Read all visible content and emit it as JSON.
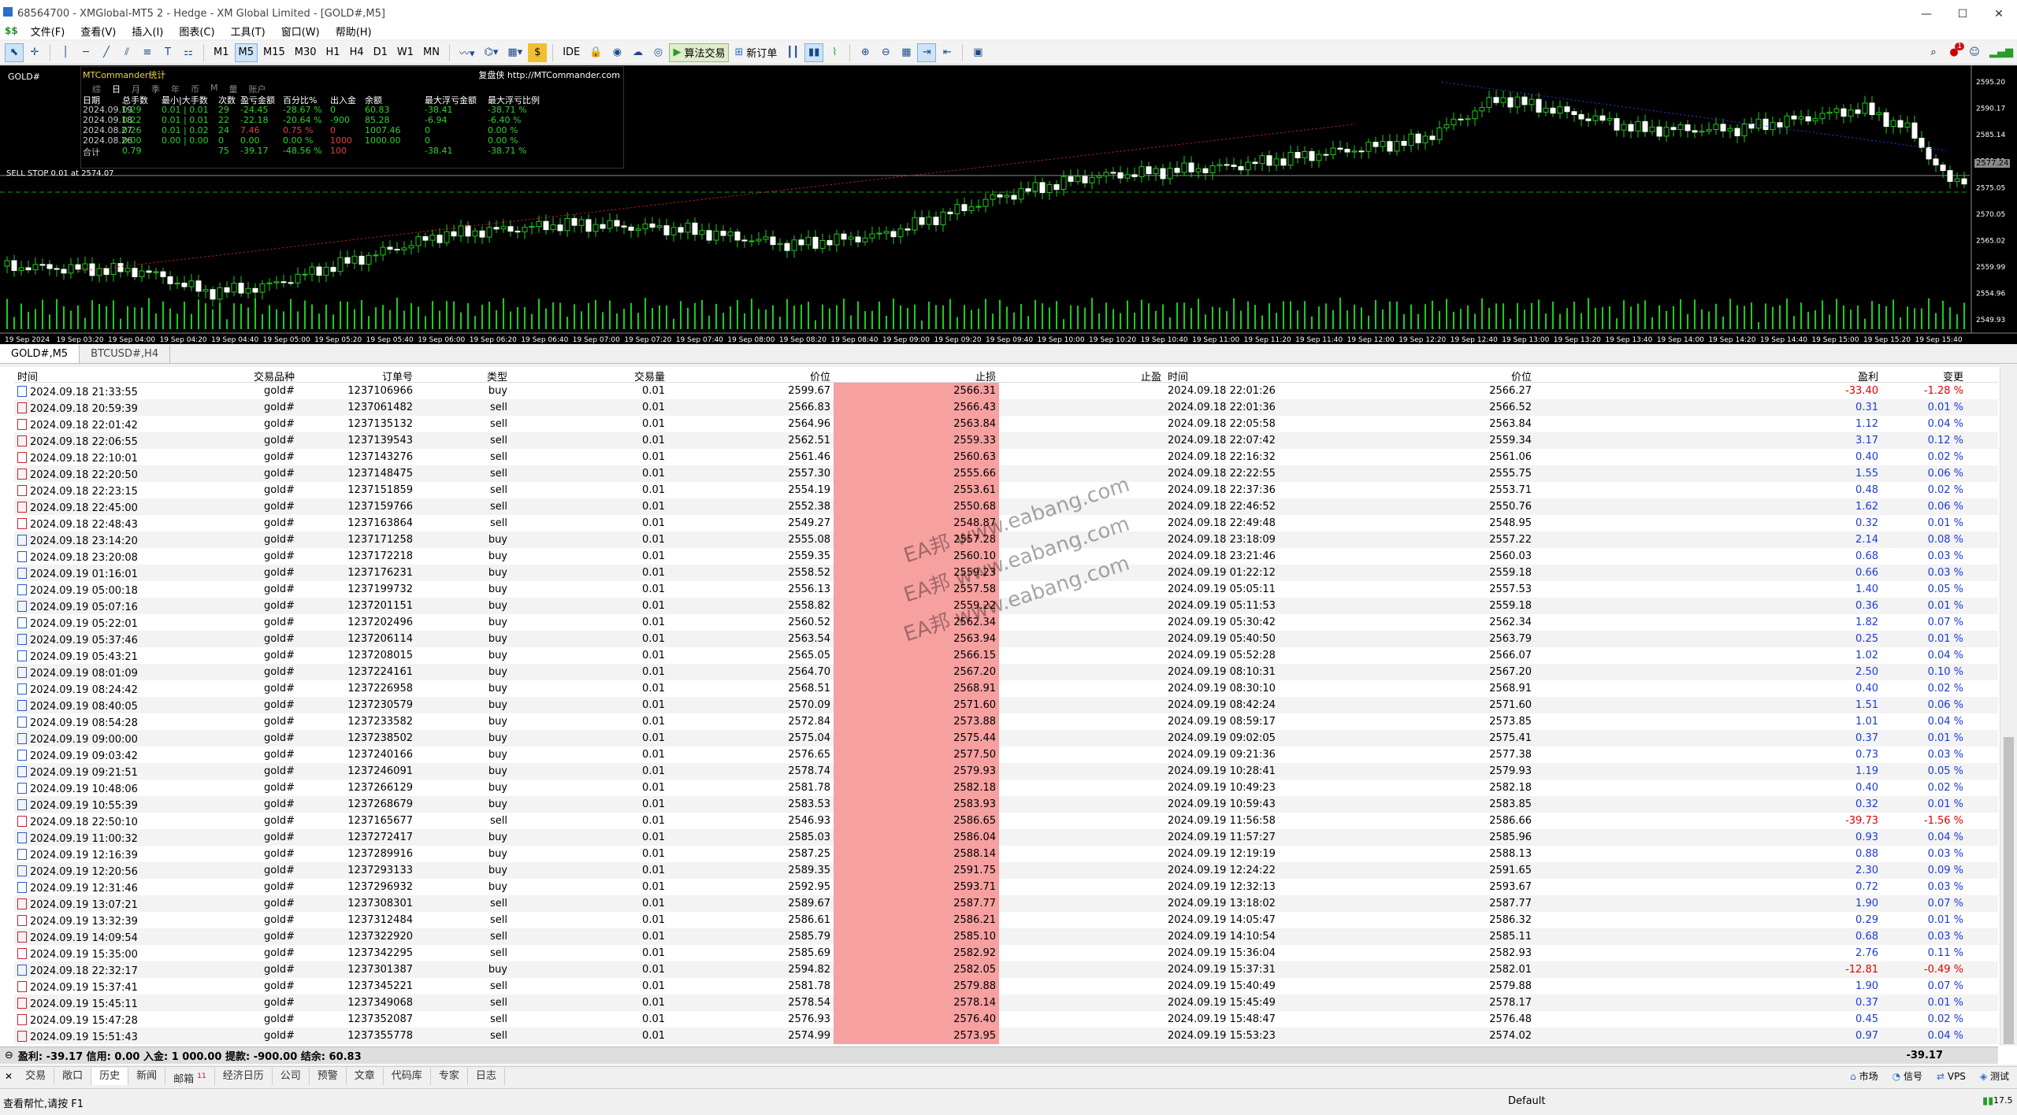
{
  "window": {
    "title": "68564700 - XMGlobal-MT5 2 - Hedge - XM Global Limited - [GOLD#,M5]"
  },
  "menu": [
    "文件(F)",
    "查看(V)",
    "插入(I)",
    "图表(C)",
    "工具(T)",
    "窗口(W)",
    "帮助(H)"
  ],
  "toolbar": {
    "timeframes": [
      "M1",
      "M5",
      "M15",
      "M30",
      "H1",
      "H4",
      "D1",
      "W1",
      "MN"
    ],
    "active_timeframe": "M5",
    "ide": "IDE",
    "algo": "算法交易",
    "new_order": "新订单",
    "notif_count": "1"
  },
  "chart": {
    "symbol": "GOLD#",
    "sell_stop": "SELL STOP 0.01 at 2574.07",
    "current_price": "2577.24",
    "price_ticks": [
      "2595.20",
      "2590.17",
      "2585.14",
      "2580.11",
      "2575.05",
      "2570.05",
      "2565.02",
      "2559.99",
      "2554.96",
      "2549.93"
    ],
    "time_ticks": [
      "19 Sep 2024",
      "19 Sep 03:20",
      "19 Sep 04:00",
      "19 Sep 04:20",
      "19 Sep 04:40",
      "19 Sep 05:00",
      "19 Sep 05:20",
      "19 Sep 05:40",
      "19 Sep 06:00",
      "19 Sep 06:20",
      "19 Sep 06:40",
      "19 Sep 07:00",
      "19 Sep 07:20",
      "19 Sep 07:40",
      "19 Sep 08:00",
      "19 Sep 08:20",
      "19 Sep 08:40",
      "19 Sep 09:00",
      "19 Sep 09:20",
      "19 Sep 09:40",
      "19 Sep 10:00",
      "19 Sep 10:20",
      "19 Sep 10:40",
      "19 Sep 11:00",
      "19 Sep 11:20",
      "19 Sep 11:40",
      "19 Sep 12:00",
      "19 Sep 12:20",
      "19 Sep 12:40",
      "19 Sep 13:00",
      "19 Sep 13:20",
      "19 Sep 13:40",
      "19 Sep 14:00",
      "19 Sep 14:20",
      "19 Sep 14:40",
      "19 Sep 15:00",
      "19 Sep 15:20",
      "19 Sep 15:40"
    ]
  },
  "mtc": {
    "title": "MTCommander统计",
    "link": "复盘侠 http://MTCommander.com",
    "tabs": [
      "综",
      "日",
      "月",
      "季",
      "年",
      "币",
      "M",
      "量",
      "账户"
    ],
    "headers": [
      "日期",
      "总手数",
      "最小|大手数",
      "次数",
      "盈亏金额",
      "百分比%",
      "出入金",
      "余额",
      "最大浮亏金额",
      "最大浮亏比例"
    ],
    "rows": [
      [
        "2024.09.19",
        "0.29",
        "0.01 | 0.01",
        "29",
        "-24.45",
        "-28.67 %",
        "0",
        "60.83",
        "-38.41",
        "-38.71 %"
      ],
      [
        "2024.09.18",
        "0.22",
        "0.01 | 0.01",
        "22",
        "-22.18",
        "-20.64 %",
        "-900",
        "85.28",
        "-6.94",
        "-6.40 %"
      ],
      [
        "2024.08.27",
        "0.26",
        "0.01 | 0.02",
        "24",
        "7.46",
        "0.75 %",
        "0",
        "1007.46",
        "0",
        "0.00 %"
      ],
      [
        "2024.08.26",
        "0.00",
        "0.00 | 0.00",
        "0",
        "0.00",
        "0.00 %",
        "1000",
        "1000.00",
        "0",
        "0.00 %"
      ],
      [
        "合计",
        "0.79",
        "",
        "75",
        "-39.17",
        "-48.56 %",
        "100",
        "",
        "-38.41",
        "-38.71 %"
      ]
    ]
  },
  "chart_tabs": [
    "GOLD#,M5",
    "BTCUSD#,H4"
  ],
  "history": {
    "headers": [
      "时间",
      "交易品种",
      "订单号",
      "类型",
      "交易量",
      "价位",
      "止损",
      "止盈",
      "时间",
      "价位",
      "盈利",
      "变更"
    ],
    "rows": [
      [
        "2024.09.18 21:33:55",
        "gold#",
        "1237106966",
        "buy",
        "0.01",
        "2599.67",
        "2566.31",
        "",
        "2024.09.18 22:01:26",
        "2566.27",
        "-33.40",
        "-1.28 %"
      ],
      [
        "2024.09.18 20:59:39",
        "gold#",
        "1237061482",
        "sell",
        "0.01",
        "2566.83",
        "2566.43",
        "",
        "2024.09.18 22:01:36",
        "2566.52",
        "0.31",
        "0.01 %"
      ],
      [
        "2024.09.18 22:01:42",
        "gold#",
        "1237135132",
        "sell",
        "0.01",
        "2564.96",
        "2563.84",
        "",
        "2024.09.18 22:05:58",
        "2563.84",
        "1.12",
        "0.04 %"
      ],
      [
        "2024.09.18 22:06:55",
        "gold#",
        "1237139543",
        "sell",
        "0.01",
        "2562.51",
        "2559.33",
        "",
        "2024.09.18 22:07:42",
        "2559.34",
        "3.17",
        "0.12 %"
      ],
      [
        "2024.09.18 22:10:01",
        "gold#",
        "1237143276",
        "sell",
        "0.01",
        "2561.46",
        "2560.63",
        "",
        "2024.09.18 22:16:32",
        "2561.06",
        "0.40",
        "0.02 %"
      ],
      [
        "2024.09.18 22:20:50",
        "gold#",
        "1237148475",
        "sell",
        "0.01",
        "2557.30",
        "2555.66",
        "",
        "2024.09.18 22:22:55",
        "2555.75",
        "1.55",
        "0.06 %"
      ],
      [
        "2024.09.18 22:23:15",
        "gold#",
        "1237151859",
        "sell",
        "0.01",
        "2554.19",
        "2553.61",
        "",
        "2024.09.18 22:37:36",
        "2553.71",
        "0.48",
        "0.02 %"
      ],
      [
        "2024.09.18 22:45:00",
        "gold#",
        "1237159766",
        "sell",
        "0.01",
        "2552.38",
        "2550.68",
        "",
        "2024.09.18 22:46:52",
        "2550.76",
        "1.62",
        "0.06 %"
      ],
      [
        "2024.09.18 22:48:43",
        "gold#",
        "1237163864",
        "sell",
        "0.01",
        "2549.27",
        "2548.87",
        "",
        "2024.09.18 22:49:48",
        "2548.95",
        "0.32",
        "0.01 %"
      ],
      [
        "2024.09.18 23:14:20",
        "gold#",
        "1237171258",
        "buy",
        "0.01",
        "2555.08",
        "2557.28",
        "",
        "2024.09.18 23:18:09",
        "2557.22",
        "2.14",
        "0.08 %"
      ],
      [
        "2024.09.18 23:20:08",
        "gold#",
        "1237172218",
        "buy",
        "0.01",
        "2559.35",
        "2560.10",
        "",
        "2024.09.18 23:21:46",
        "2560.03",
        "0.68",
        "0.03 %"
      ],
      [
        "2024.09.19 01:16:01",
        "gold#",
        "1237176231",
        "buy",
        "0.01",
        "2558.52",
        "2559.23",
        "",
        "2024.09.19 01:22:12",
        "2559.18",
        "0.66",
        "0.03 %"
      ],
      [
        "2024.09.19 05:00:18",
        "gold#",
        "1237199732",
        "buy",
        "0.01",
        "2556.13",
        "2557.58",
        "",
        "2024.09.19 05:05:11",
        "2557.53",
        "1.40",
        "0.05 %"
      ],
      [
        "2024.09.19 05:07:16",
        "gold#",
        "1237201151",
        "buy",
        "0.01",
        "2558.82",
        "2559.22",
        "",
        "2024.09.19 05:11:53",
        "2559.18",
        "0.36",
        "0.01 %"
      ],
      [
        "2024.09.19 05:22:01",
        "gold#",
        "1237202496",
        "buy",
        "0.01",
        "2560.52",
        "2562.34",
        "",
        "2024.09.19 05:30:42",
        "2562.34",
        "1.82",
        "0.07 %"
      ],
      [
        "2024.09.19 05:37:46",
        "gold#",
        "1237206114",
        "buy",
        "0.01",
        "2563.54",
        "2563.94",
        "",
        "2024.09.19 05:40:50",
        "2563.79",
        "0.25",
        "0.01 %"
      ],
      [
        "2024.09.19 05:43:21",
        "gold#",
        "1237208015",
        "buy",
        "0.01",
        "2565.05",
        "2566.15",
        "",
        "2024.09.19 05:52:28",
        "2566.07",
        "1.02",
        "0.04 %"
      ],
      [
        "2024.09.19 08:01:09",
        "gold#",
        "1237224161",
        "buy",
        "0.01",
        "2564.70",
        "2567.20",
        "",
        "2024.09.19 08:10:31",
        "2567.20",
        "2.50",
        "0.10 %"
      ],
      [
        "2024.09.19 08:24:42",
        "gold#",
        "1237226958",
        "buy",
        "0.01",
        "2568.51",
        "2568.91",
        "",
        "2024.09.19 08:30:10",
        "2568.91",
        "0.40",
        "0.02 %"
      ],
      [
        "2024.09.19 08:40:05",
        "gold#",
        "1237230579",
        "buy",
        "0.01",
        "2570.09",
        "2571.60",
        "",
        "2024.09.19 08:42:24",
        "2571.60",
        "1.51",
        "0.06 %"
      ],
      [
        "2024.09.19 08:54:28",
        "gold#",
        "1237233582",
        "buy",
        "0.01",
        "2572.84",
        "2573.88",
        "",
        "2024.09.19 08:59:17",
        "2573.85",
        "1.01",
        "0.04 %"
      ],
      [
        "2024.09.19 09:00:00",
        "gold#",
        "1237238502",
        "buy",
        "0.01",
        "2575.04",
        "2575.44",
        "",
        "2024.09.19 09:02:05",
        "2575.41",
        "0.37",
        "0.01 %"
      ],
      [
        "2024.09.19 09:03:42",
        "gold#",
        "1237240166",
        "buy",
        "0.01",
        "2576.65",
        "2577.50",
        "",
        "2024.09.19 09:21:36",
        "2577.38",
        "0.73",
        "0.03 %"
      ],
      [
        "2024.09.19 09:21:51",
        "gold#",
        "1237246091",
        "buy",
        "0.01",
        "2578.74",
        "2579.93",
        "",
        "2024.09.19 10:28:41",
        "2579.93",
        "1.19",
        "0.05 %"
      ],
      [
        "2024.09.19 10:48:06",
        "gold#",
        "1237266129",
        "buy",
        "0.01",
        "2581.78",
        "2582.18",
        "",
        "2024.09.19 10:49:23",
        "2582.18",
        "0.40",
        "0.02 %"
      ],
      [
        "2024.09.19 10:55:39",
        "gold#",
        "1237268679",
        "buy",
        "0.01",
        "2583.53",
        "2583.93",
        "",
        "2024.09.19 10:59:43",
        "2583.85",
        "0.32",
        "0.01 %"
      ],
      [
        "2024.09.18 22:50:10",
        "gold#",
        "1237165677",
        "sell",
        "0.01",
        "2546.93",
        "2586.65",
        "",
        "2024.09.19 11:56:58",
        "2586.66",
        "-39.73",
        "-1.56 %"
      ],
      [
        "2024.09.19 11:00:32",
        "gold#",
        "1237272417",
        "buy",
        "0.01",
        "2585.03",
        "2586.04",
        "",
        "2024.09.19 11:57:27",
        "2585.96",
        "0.93",
        "0.04 %"
      ],
      [
        "2024.09.19 12:16:39",
        "gold#",
        "1237289916",
        "buy",
        "0.01",
        "2587.25",
        "2588.14",
        "",
        "2024.09.19 12:19:19",
        "2588.13",
        "0.88",
        "0.03 %"
      ],
      [
        "2024.09.19 12:20:56",
        "gold#",
        "1237293133",
        "buy",
        "0.01",
        "2589.35",
        "2591.75",
        "",
        "2024.09.19 12:24:22",
        "2591.65",
        "2.30",
        "0.09 %"
      ],
      [
        "2024.09.19 12:31:46",
        "gold#",
        "1237296932",
        "buy",
        "0.01",
        "2592.95",
        "2593.71",
        "",
        "2024.09.19 12:32:13",
        "2593.67",
        "0.72",
        "0.03 %"
      ],
      [
        "2024.09.19 13:07:21",
        "gold#",
        "1237308301",
        "sell",
        "0.01",
        "2589.67",
        "2587.77",
        "",
        "2024.09.19 13:18:02",
        "2587.77",
        "1.90",
        "0.07 %"
      ],
      [
        "2024.09.19 13:32:39",
        "gold#",
        "1237312484",
        "sell",
        "0.01",
        "2586.61",
        "2586.21",
        "",
        "2024.09.19 14:05:47",
        "2586.32",
        "0.29",
        "0.01 %"
      ],
      [
        "2024.09.19 14:09:54",
        "gold#",
        "1237322920",
        "sell",
        "0.01",
        "2585.79",
        "2585.10",
        "",
        "2024.09.19 14:10:54",
        "2585.11",
        "0.68",
        "0.03 %"
      ],
      [
        "2024.09.19 15:35:00",
        "gold#",
        "1237342295",
        "sell",
        "0.01",
        "2585.69",
        "2582.92",
        "",
        "2024.09.19 15:36:04",
        "2582.93",
        "2.76",
        "0.11 %"
      ],
      [
        "2024.09.18 22:32:17",
        "gold#",
        "1237301387",
        "buy",
        "0.01",
        "2594.82",
        "2582.05",
        "",
        "2024.09.19 15:37:31",
        "2582.01",
        "-12.81",
        "-0.49 %"
      ],
      [
        "2024.09.19 15:37:41",
        "gold#",
        "1237345221",
        "sell",
        "0.01",
        "2581.78",
        "2579.88",
        "",
        "2024.09.19 15:40:49",
        "2579.88",
        "1.90",
        "0.07 %"
      ],
      [
        "2024.09.19 15:45:11",
        "gold#",
        "1237349068",
        "sell",
        "0.01",
        "2578.54",
        "2578.14",
        "",
        "2024.09.19 15:45:49",
        "2578.17",
        "0.37",
        "0.01 %"
      ],
      [
        "2024.09.19 15:47:28",
        "gold#",
        "1237352087",
        "sell",
        "0.01",
        "2576.93",
        "2576.40",
        "",
        "2024.09.19 15:48:47",
        "2576.48",
        "0.45",
        "0.02 %"
      ],
      [
        "2024.09.19 15:51:43",
        "gold#",
        "1237355778",
        "sell",
        "0.01",
        "2574.99",
        "2573.95",
        "",
        "2024.09.19 15:53:23",
        "2574.02",
        "0.97",
        "0.04 %"
      ]
    ],
    "summary": "盈利: -39.17  信用: 0.00  入金: 1 000.00  提款: -900.00  结余: 60.83",
    "summary_total": "-39.17"
  },
  "watermark": "EA邦 www.eabang.com",
  "bottom_tabs": [
    "交易",
    "敞口",
    "历史",
    "新闻",
    "邮箱",
    "经济日历",
    "公司",
    "预警",
    "文章",
    "代码库",
    "专家",
    "日志"
  ],
  "mail_badge": "11",
  "bottom_right": [
    "市场",
    "信号",
    "VPS",
    "测试"
  ],
  "status": {
    "help": "查看帮忙,请按 F1",
    "profile": "Default",
    "speed": "17.5"
  }
}
